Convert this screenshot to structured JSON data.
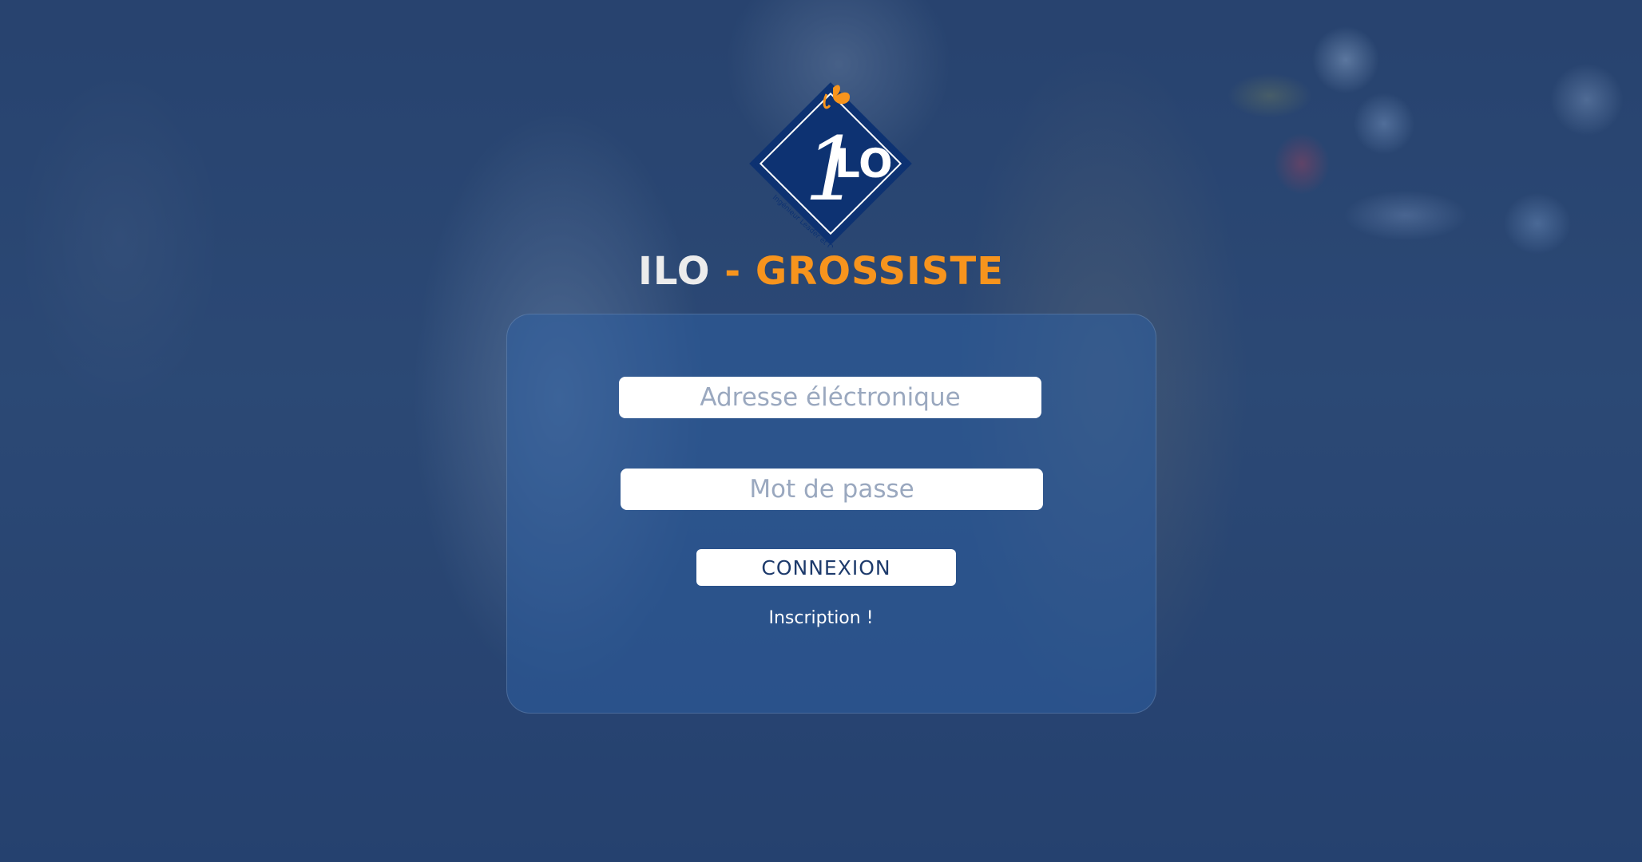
{
  "brand": {
    "title_part1": "ILO",
    "title_part2": " - GROSSISTE",
    "logo_text": "LO",
    "logo_numeral": "1",
    "logo_tagline": "Ingénieur Leader et Opérationnel",
    "colors": {
      "primary_blue": "#0d3272",
      "accent_orange": "#f7941d",
      "title_white": "#ececec"
    }
  },
  "login": {
    "email_placeholder": "Adresse éléctronique",
    "password_placeholder": "Mot de passe",
    "submit_label": "CONNEXION",
    "register_link": "Inscription !"
  }
}
